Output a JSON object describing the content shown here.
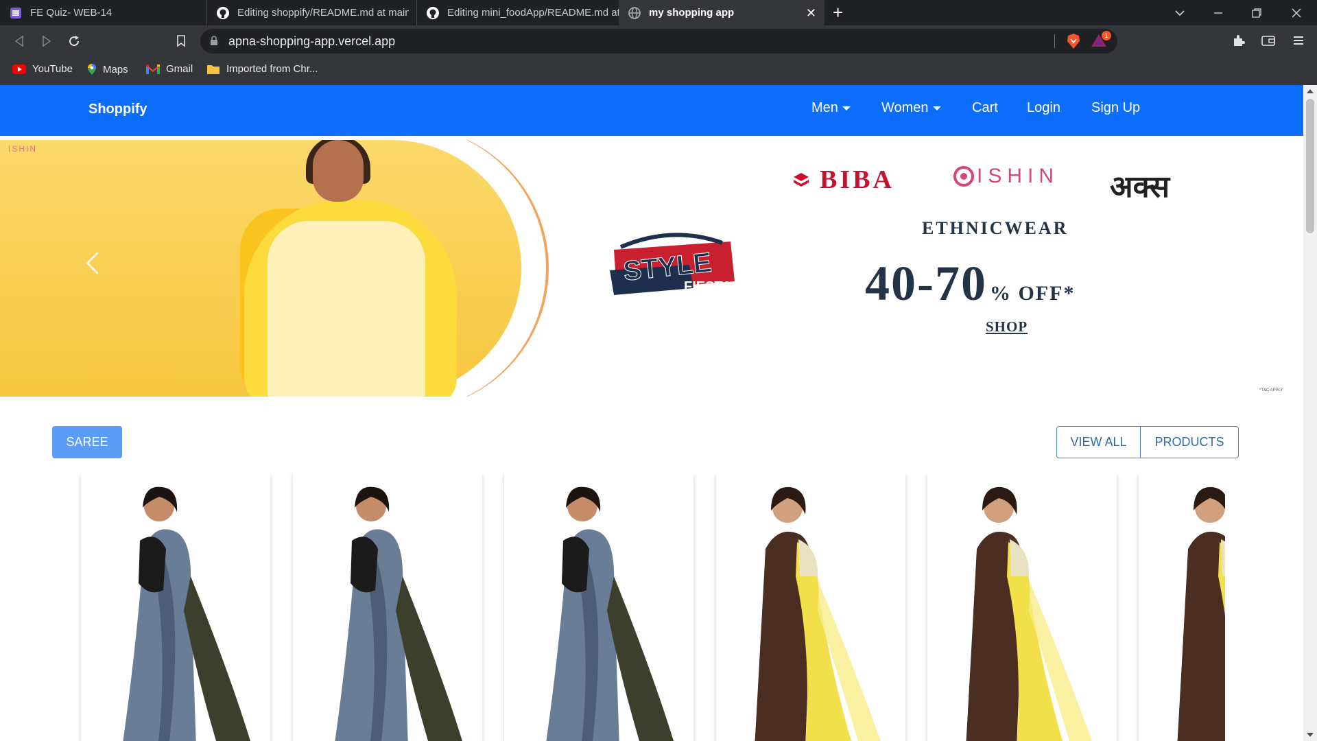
{
  "browser": {
    "tabs": [
      {
        "title": "FE Quiz- WEB-14",
        "icon": "quiz-icon"
      },
      {
        "title": "Editing shoppify/README.md at main",
        "icon": "github-icon"
      },
      {
        "title": "Editing mini_foodApp/README.md at",
        "icon": "github-icon"
      },
      {
        "title": "my shopping app",
        "icon": "globe-icon",
        "active": true
      }
    ],
    "url": "apna-shopping-app.vercel.app",
    "notification_badge": "1",
    "bookmarks": [
      {
        "label": "YouTube",
        "icon": "youtube-icon"
      },
      {
        "label": "Maps",
        "icon": "maps-icon"
      },
      {
        "label": "Gmail",
        "icon": "gmail-icon"
      },
      {
        "label": "Imported from Chr...",
        "icon": "folder-icon"
      }
    ]
  },
  "navbar": {
    "brand": "Shoppify",
    "links": [
      {
        "label": "Men",
        "dropdown": true
      },
      {
        "label": "Women",
        "dropdown": true
      },
      {
        "label": "Cart"
      },
      {
        "label": "Login"
      },
      {
        "label": "Sign Up"
      }
    ],
    "color": "#0d6efd"
  },
  "banner": {
    "corner_logo": "ISHIN",
    "style_logo_line1": "STYLE",
    "style_logo_line2": "FIESTA",
    "brands": [
      "BIBA",
      "ISHIN",
      "अक्स"
    ],
    "category": "ETHNICWEAR",
    "offer_range": "40-70",
    "offer_suffix": "% OFF*",
    "cta": "SHOP",
    "tnc": "*T&C APPLY"
  },
  "section": {
    "category_button": "SAREE",
    "view_all_button": "VIEW ALL",
    "products_button": "PRODUCTS"
  },
  "products": [
    {
      "color_variant": "grey-saree"
    },
    {
      "color_variant": "grey-saree"
    },
    {
      "color_variant": "grey-saree"
    },
    {
      "color_variant": "yellow-brown-saree"
    },
    {
      "color_variant": "yellow-brown-saree"
    },
    {
      "color_variant": "yellow-brown-saree"
    }
  ]
}
